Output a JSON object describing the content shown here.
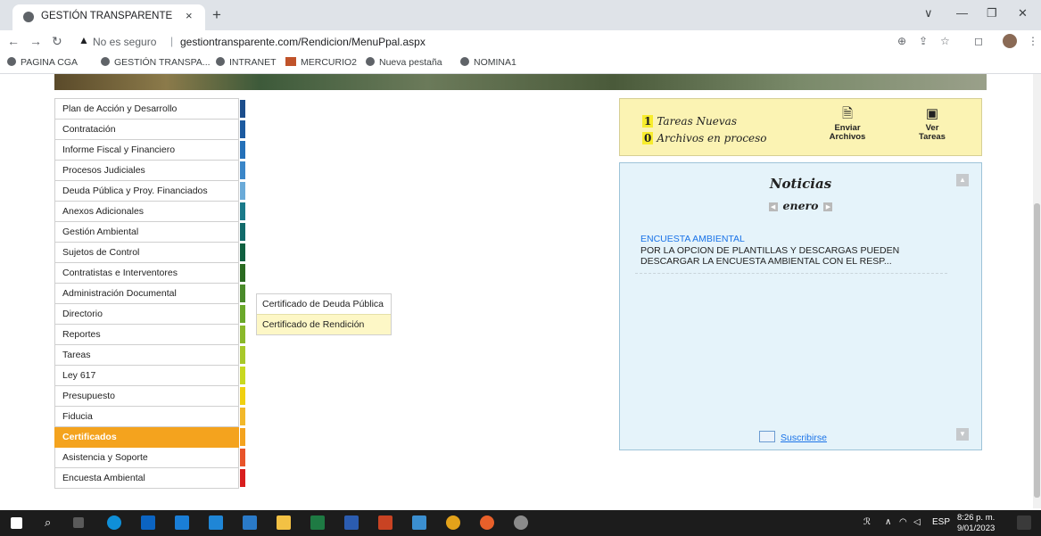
{
  "browser": {
    "tab_title": "GESTIÓN TRANSPARENTE",
    "tab_close": "×",
    "new_tab": "+",
    "security_label": "No es seguro",
    "separator": "|",
    "url": "gestiontransparente.com/Rendicion/MenuPpal.aspx",
    "window_controls": [
      "∨",
      "—",
      "❐",
      "✕"
    ]
  },
  "bookmarks": [
    {
      "label": "PAGINA CGA",
      "icon": "globe-icon"
    },
    {
      "label": "GESTIÓN TRANSPA...",
      "icon": "globe-icon"
    },
    {
      "label": "INTRANET",
      "icon": "globe-icon"
    },
    {
      "label": "MERCURIO2",
      "icon": "image-icon"
    },
    {
      "label": "Nueva pestaña",
      "icon": "globe-icon"
    },
    {
      "label": "NOMINA1",
      "icon": "globe-icon"
    }
  ],
  "menu": {
    "items": [
      {
        "label": "Plan de Acción y Desarrollo",
        "color": "#1c4e8c"
      },
      {
        "label": "Contratación",
        "color": "#1c5aa0"
      },
      {
        "label": "Informe Fiscal y Financiero",
        "color": "#2470b8"
      },
      {
        "label": "Procesos Judiciales",
        "color": "#3a86c8"
      },
      {
        "label": "Deuda Pública y Proy. Financiados",
        "color": "#6aaad8"
      },
      {
        "label": "Anexos Adicionales",
        "color": "#1a7a8a"
      },
      {
        "label": "Gestión Ambiental",
        "color": "#116a6a"
      },
      {
        "label": "Sujetos de Control",
        "color": "#106040"
      },
      {
        "label": "Contratistas e Interventores",
        "color": "#2a6a20"
      },
      {
        "label": "Administración Documental",
        "color": "#4a8a2a"
      },
      {
        "label": "Directorio",
        "color": "#6aa82a"
      },
      {
        "label": "Reportes",
        "color": "#8ab82a"
      },
      {
        "label": "Tareas",
        "color": "#a8c82a"
      },
      {
        "label": "Ley 617",
        "color": "#c8d820"
      },
      {
        "label": "Presupuesto",
        "color": "#f0d010"
      },
      {
        "label": "Fiducia",
        "color": "#f2b82a"
      },
      {
        "label": "Certificados",
        "color": "#f4a31e",
        "active": true
      },
      {
        "label": "Asistencia y Soporte",
        "color": "#e8542a"
      },
      {
        "label": "Encuesta Ambiental",
        "color": "#d81e1e"
      }
    ]
  },
  "submenu": {
    "items": [
      "Certificado de Deuda Pública",
      "Certificado de Rendición"
    ]
  },
  "tasks": {
    "new_count": "1",
    "new_label": "Tareas Nuevas",
    "process_count": "0",
    "process_label": "Archivos en proceso",
    "send_line1": "Enviar",
    "send_line2": "Archivos",
    "view_line1": "Ver",
    "view_line2": "Tareas"
  },
  "news": {
    "title": "Noticias",
    "month": "enero",
    "headline": "ENCUESTA AMBIENTAL",
    "body": "POR LA OPCION DE PLANTILLAS Y DESCARGAS PUEDEN DESCARGAR LA ENCUESTA AMBIENTAL CON EL RESP...",
    "subscribe": "Suscribirse"
  },
  "taskbar": {
    "lang": "ESP",
    "time": "8:26 p. m.",
    "date": "9/01/2023"
  }
}
